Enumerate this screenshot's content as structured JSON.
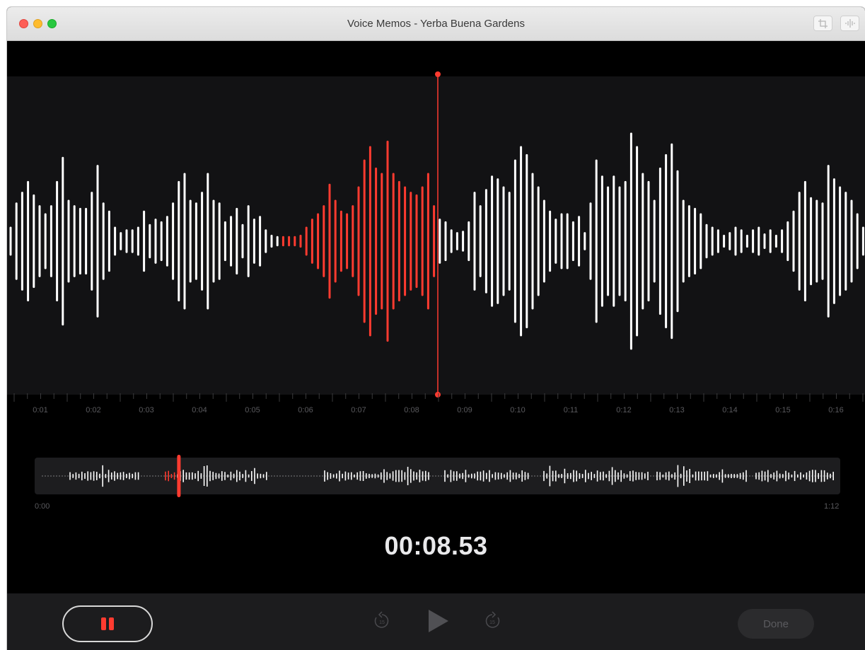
{
  "window": {
    "title": "Voice Memos - Yerba Buena Gardens",
    "toolbar_icons": [
      "crop-icon",
      "enhance-waveform-icon"
    ]
  },
  "timeline": {
    "ticks": [
      "0:01",
      "0:02",
      "0:03",
      "0:04",
      "0:05",
      "0:06",
      "0:07",
      "0:08",
      "0:09",
      "0:10",
      "0:11",
      "0:12",
      "0:13",
      "0:14",
      "0:15",
      "0:16"
    ]
  },
  "overview": {
    "start_label": "0:00",
    "end_label": "1:12",
    "playhead_fraction": 0.118
  },
  "playback": {
    "current_time": "00:08.53",
    "done_label": "Done",
    "skip_back_seconds": "15",
    "skip_forward_seconds": "15"
  },
  "colors": {
    "accent": "#ff3b30",
    "wave_played": "#ff3b30",
    "wave_unplayed": "#ffffff"
  }
}
